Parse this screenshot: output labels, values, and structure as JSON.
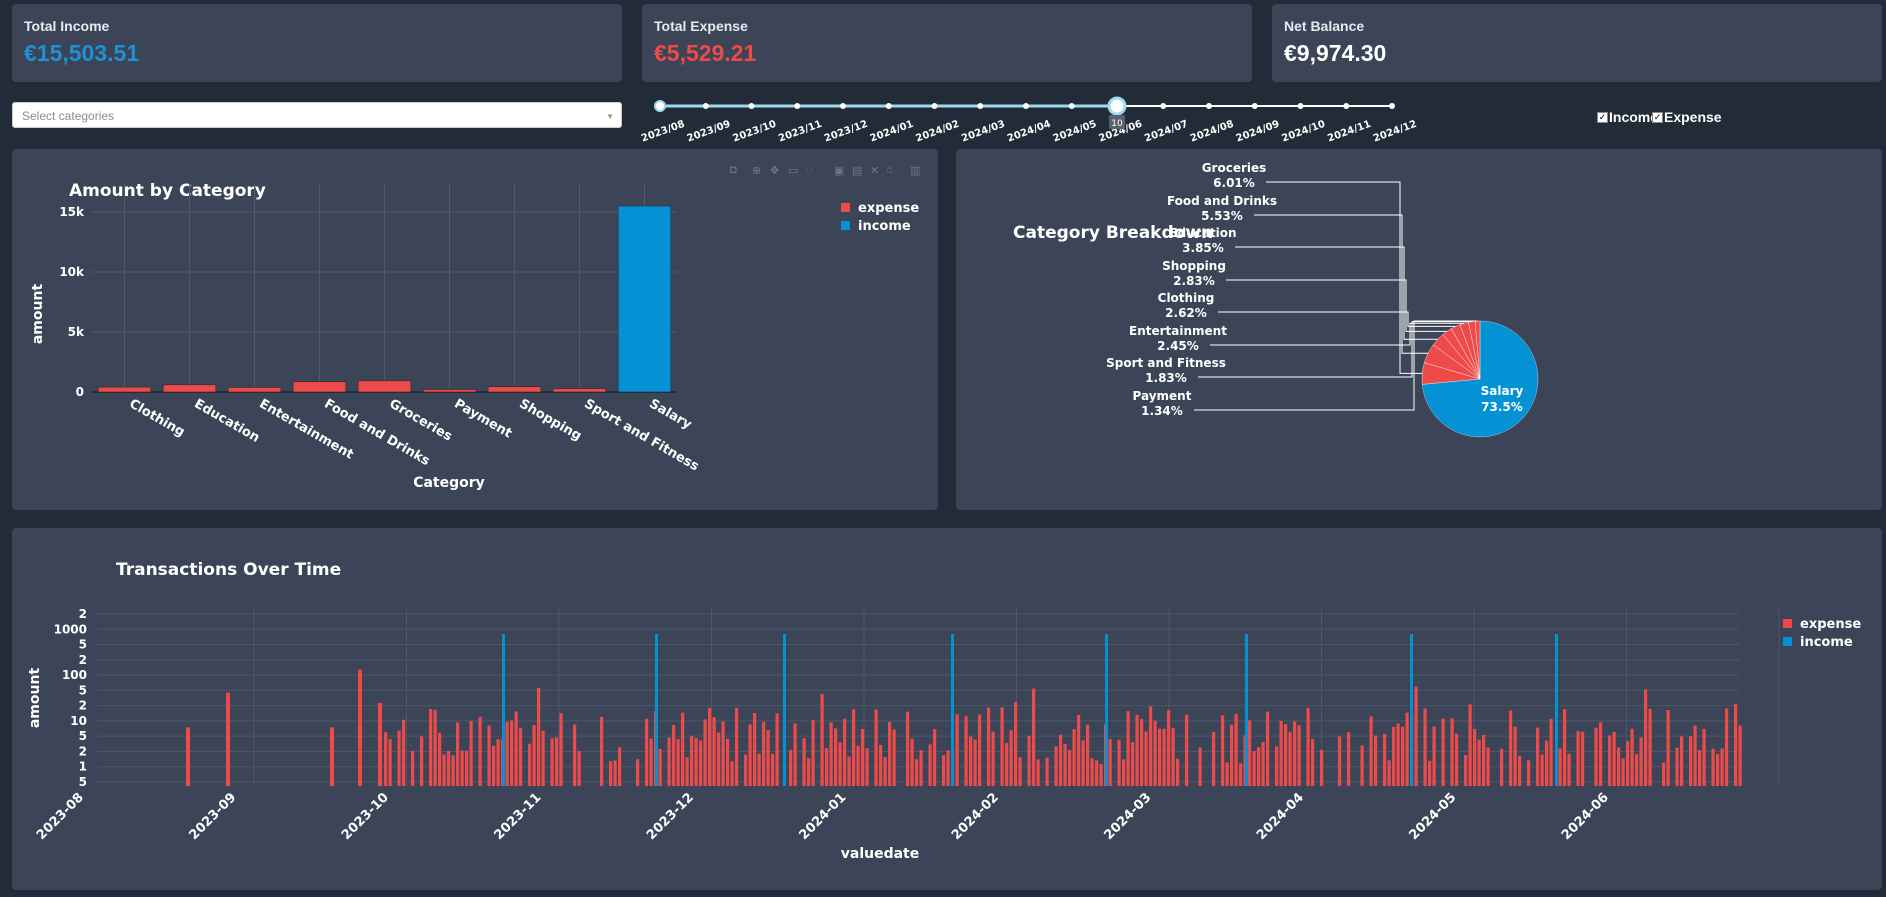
{
  "kpis": [
    {
      "label": "Total Income",
      "value": "€15,503.51",
      "color": "#1e90d6"
    },
    {
      "label": "Total Expense",
      "value": "€5,529.21",
      "color": "#ef4a4a"
    },
    {
      "label": "Net Balance",
      "value": "€9,974.30",
      "color": "#ffffff"
    }
  ],
  "filters": {
    "category_placeholder": "Select categories",
    "slider_ticks": [
      "2023/08",
      "2023/09",
      "2023/10",
      "2023/11",
      "2023/12",
      "2024/01",
      "2024/02",
      "2024/03",
      "2024/04",
      "2024/05",
      "2024/06",
      "2024/07",
      "2024/08",
      "2024/09",
      "2024/10",
      "2024/11",
      "2024/12"
    ],
    "slider_value": "10",
    "checkboxes": [
      {
        "label": "Income",
        "checked": true
      },
      {
        "label": "Expense",
        "checked": true
      }
    ]
  },
  "colors": {
    "expense": "#ef4a4a",
    "income": "#0492d4",
    "panel": "#3b4557"
  },
  "chart_data": [
    {
      "type": "bar",
      "title": "Amount by Category",
      "xlabel": "Category",
      "ylabel": "amount",
      "categories": [
        "Clothing",
        "Education",
        "Entertainment",
        "Food and Drinks",
        "Groceries",
        "Payment",
        "Shopping",
        "Sport and Fitness",
        "Salary"
      ],
      "series": [
        {
          "name": "expense",
          "values": [
            405,
            596,
            380,
            857,
            931,
            207,
            439,
            284,
            0
          ]
        },
        {
          "name": "income",
          "values": [
            0,
            0,
            0,
            0,
            0,
            0,
            0,
            0,
            15503
          ]
        }
      ],
      "yticks": [
        "0",
        "5k",
        "10k",
        "15k"
      ],
      "ylim": [
        0,
        16500
      ],
      "legend": "top-right",
      "grid": true
    },
    {
      "type": "pie",
      "title": "Category Breakdown",
      "slices": [
        {
          "label": "Salary",
          "percent": "73.5%",
          "value": 73.5
        },
        {
          "label": "Groceries",
          "percent": "6.01%",
          "value": 6.01
        },
        {
          "label": "Food and Drinks",
          "percent": "5.53%",
          "value": 5.53
        },
        {
          "label": "Education",
          "percent": "3.85%",
          "value": 3.85
        },
        {
          "label": "Shopping",
          "percent": "2.83%",
          "value": 2.83
        },
        {
          "label": "Clothing",
          "percent": "2.62%",
          "value": 2.62
        },
        {
          "label": "Entertainment",
          "percent": "2.45%",
          "value": 2.45
        },
        {
          "label": "Sport and Fitness",
          "percent": "1.83%",
          "value": 1.83
        },
        {
          "label": "Payment",
          "percent": "1.34%",
          "value": 1.34
        }
      ]
    },
    {
      "type": "bar",
      "title": "Transactions Over Time",
      "xlabel": "valuedate",
      "ylabel": "amount",
      "yscale": "log",
      "ytick_labels": [
        "5",
        "1",
        "2",
        "5",
        "10",
        "2",
        "5",
        "100",
        "2",
        "5",
        "1000",
        "2"
      ],
      "xticks": [
        "2023-08",
        "2023-09",
        "2023-10",
        "2023-11",
        "2023-12",
        "2024-01",
        "2024-02",
        "2024-03",
        "2024-04",
        "2024-05",
        "2024-06"
      ],
      "x": [
        "2023-08-21",
        "2023-09-04",
        "2023-09-29",
        "2023-10-05",
        "2023-10-15",
        "2023-10-26",
        "2023-11-26",
        "2023-12-26",
        "2024-01-25",
        "2024-02-25",
        "2024-03-25",
        "2024-04-25",
        "2024-05-25",
        "2024-06-25"
      ],
      "series": [
        {
          "name": "expense",
          "values": [
            11,
            68,
            11,
            230,
            40,
            30,
            20,
            60,
            45,
            50,
            70,
            60,
            80,
            40
          ]
        },
        {
          "name": "income",
          "values": [
            1500,
            1500,
            1500,
            1500,
            1500,
            1500,
            1500,
            1500
          ]
        }
      ],
      "legend": "top-right",
      "grid": true
    }
  ]
}
